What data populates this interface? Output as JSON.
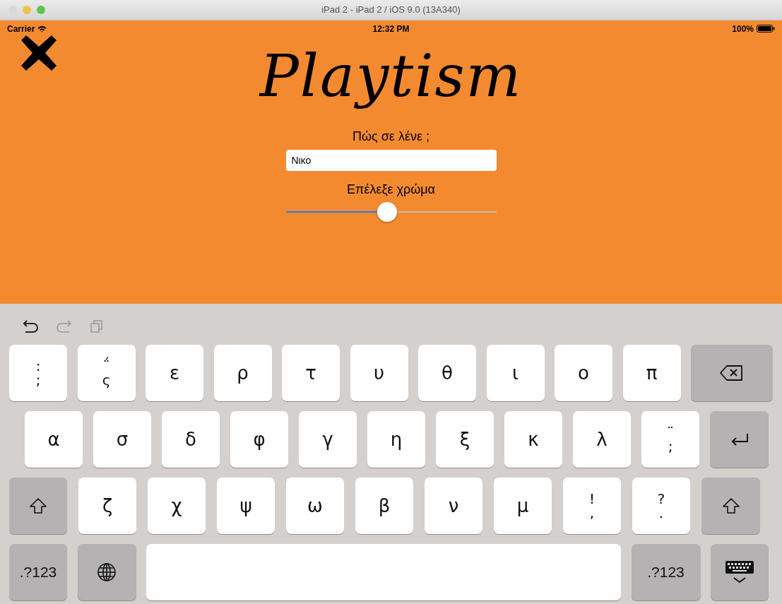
{
  "window": {
    "title": "iPad 2 - iPad 2 / iOS 9.0 (13A340)"
  },
  "status_bar": {
    "carrier": "Carrier",
    "time": "12:32 PM",
    "battery": "100%"
  },
  "app": {
    "logo": "Playtism",
    "name_label": "Πώς σε λένε ;",
    "name_field": {
      "value": "Νικο"
    },
    "color_label": "Επέλεξε χρώμα",
    "color_slider": {
      "level": 0.48
    }
  },
  "keyboard": {
    "rows": [
      {
        "keys": [
          {
            "kind": "dual",
            "top": ":",
            "bottom": ";"
          },
          {
            "kind": "dual",
            "top": "΅",
            "bottom": "ς"
          },
          {
            "kind": "letter",
            "label": "ε"
          },
          {
            "kind": "letter",
            "label": "ρ"
          },
          {
            "kind": "letter",
            "label": "τ"
          },
          {
            "kind": "letter",
            "label": "υ"
          },
          {
            "kind": "letter",
            "label": "θ"
          },
          {
            "kind": "letter",
            "label": "ι"
          },
          {
            "kind": "letter",
            "label": "ο"
          },
          {
            "kind": "letter",
            "label": "π"
          },
          {
            "kind": "backspace"
          }
        ]
      },
      {
        "keys": [
          {
            "kind": "letter",
            "label": "α"
          },
          {
            "kind": "letter",
            "label": "σ"
          },
          {
            "kind": "letter",
            "label": "δ"
          },
          {
            "kind": "letter",
            "label": "φ"
          },
          {
            "kind": "letter",
            "label": "γ"
          },
          {
            "kind": "letter",
            "label": "η"
          },
          {
            "kind": "letter",
            "label": "ξ"
          },
          {
            "kind": "letter",
            "label": "κ"
          },
          {
            "kind": "letter",
            "label": "λ"
          },
          {
            "kind": "dual",
            "top": "¨",
            "bottom": ";"
          },
          {
            "kind": "return"
          }
        ]
      },
      {
        "keys": [
          {
            "kind": "shift"
          },
          {
            "kind": "letter",
            "label": "ζ"
          },
          {
            "kind": "letter",
            "label": "χ"
          },
          {
            "kind": "letter",
            "label": "ψ"
          },
          {
            "kind": "letter",
            "label": "ω"
          },
          {
            "kind": "letter",
            "label": "β"
          },
          {
            "kind": "letter",
            "label": "ν"
          },
          {
            "kind": "letter",
            "label": "μ"
          },
          {
            "kind": "dual",
            "top": "!",
            "bottom": ","
          },
          {
            "kind": "dual",
            "top": "?",
            "bottom": "."
          },
          {
            "kind": "shift"
          }
        ]
      },
      {
        "keys": [
          {
            "kind": "mode",
            "label": ".?123"
          },
          {
            "kind": "globe"
          },
          {
            "kind": "space"
          },
          {
            "kind": "mode",
            "label": ".?123"
          },
          {
            "kind": "dismiss"
          }
        ]
      }
    ]
  }
}
